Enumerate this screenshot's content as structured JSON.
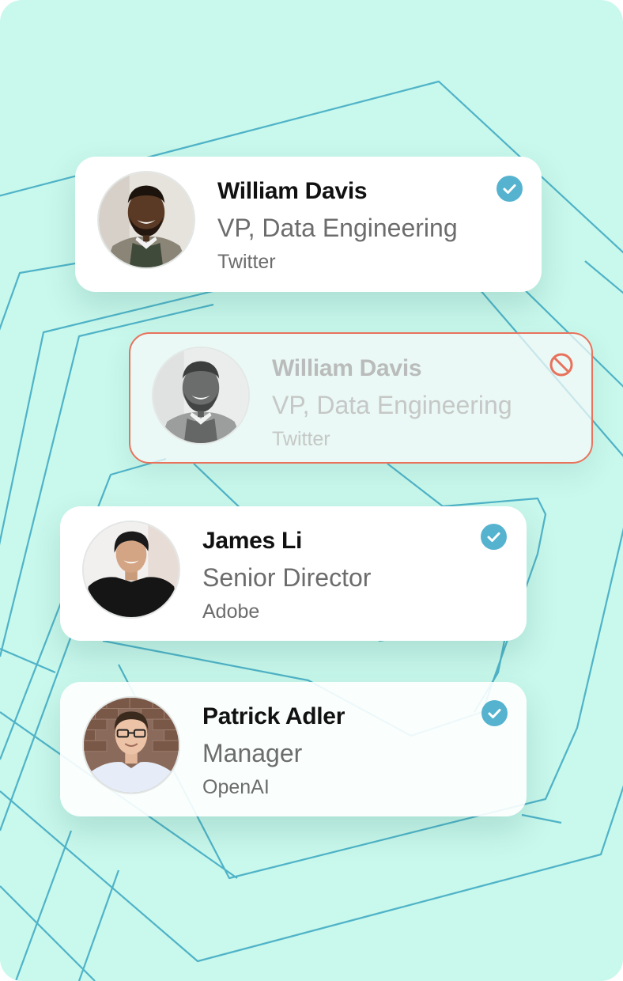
{
  "colors": {
    "background": "#c9f8ec",
    "line": "#4fb3c8",
    "check": "#55b3cf",
    "blocked": "#e8725c"
  },
  "contacts": [
    {
      "name": "William Davis",
      "title": "VP, Data Engineering",
      "company": "Twitter",
      "status_icon": "check-circle-icon",
      "avatar": "man-dark-beard-sweater"
    },
    {
      "name": "William Davis",
      "title": "VP, Data Engineering",
      "company": "Twitter",
      "status_icon": "blocked-icon",
      "avatar": "man-dark-beard-sweater-grayscale"
    },
    {
      "name": "James Li",
      "title": "Senior Director",
      "company": "Adobe",
      "status_icon": "check-circle-icon",
      "avatar": "man-black-shirt"
    },
    {
      "name": "Patrick Adler",
      "title": "Manager",
      "company": "OpenAI",
      "status_icon": "check-circle-icon",
      "avatar": "man-glasses-white-shirt"
    }
  ]
}
